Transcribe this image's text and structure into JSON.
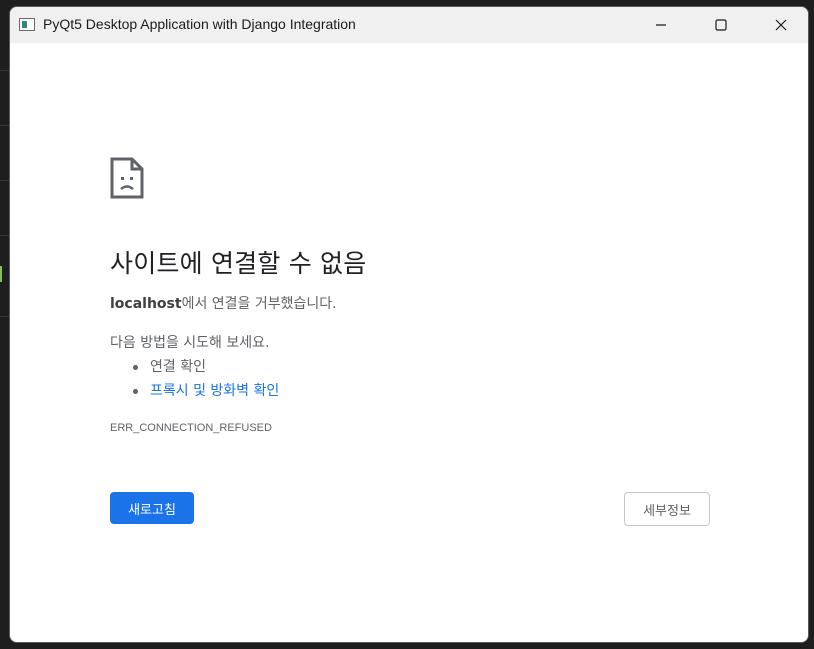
{
  "window": {
    "title": "PyQt5 Desktop Application with Django Integration",
    "controls": {
      "minimize": "minimize-icon",
      "maximize": "maximize-icon",
      "close": "close-icon"
    }
  },
  "error_page": {
    "icon": "sad-page-icon",
    "heading": "사이트에 연결할 수 없음",
    "host": "localhost",
    "host_message": "에서 연결을 거부했습니다.",
    "try_label": "다음 방법을 시도해 보세요.",
    "suggestions": [
      {
        "text": "연결 확인",
        "link": false
      },
      {
        "text": "프록시 및 방화벽 확인",
        "link": true
      }
    ],
    "error_code": "ERR_CONNECTION_REFUSED",
    "reload_label": "새로고침",
    "details_label": "세부정보"
  },
  "colors": {
    "accent": "#1a73e8",
    "text_primary": "#202124",
    "text_secondary": "#5f6368",
    "titlebar": "#f0f0f0"
  }
}
